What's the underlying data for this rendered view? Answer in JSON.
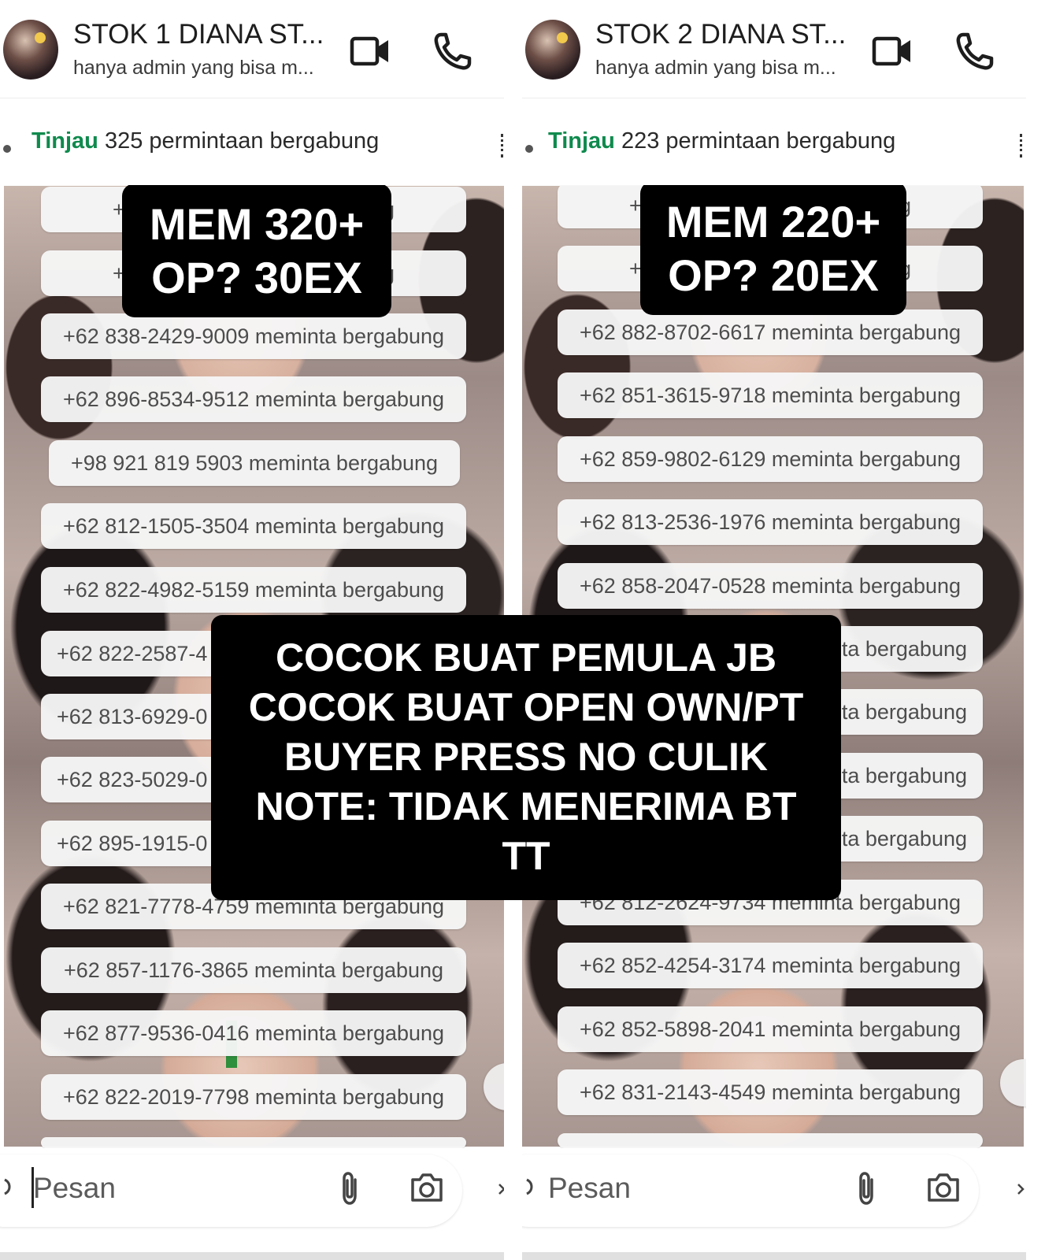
{
  "panels": [
    {
      "title": "STOK 1 DIANA ST...",
      "subtitle": "hanya admin yang bisa m...",
      "review_link": "Tinjau",
      "review_text": "325 permintaan bergabung",
      "stat_line1": "MEM 320+",
      "stat_line2": "OP? 30EX",
      "composer_placeholder": "Pesan",
      "notices": [
        "+62 81… meminta bergabung",
        "+62 85… meminta bergabung",
        "+62 838-2429-9009 meminta bergabung",
        "+62 896-8534-9512 meminta bergabung",
        "+98 921 819 5903 meminta bergabung",
        "+62 812-1505-3504 meminta bergabung",
        "+62 822-4982-5159 meminta bergabung",
        "+62 822-2587-4",
        "+62 813-6929-0",
        "+62 823-5029-0",
        "+62 895-1915-0",
        "+62 821-7778-4759 meminta bergabung",
        "+62 857-1176-3865 meminta bergabung",
        "+62 877-9536-0416 meminta bergabung",
        "+62 822-2019-7798 meminta bergabung"
      ]
    },
    {
      "title": "STOK 2 DIANA ST...",
      "subtitle": "hanya admin yang bisa m...",
      "review_link": "Tinjau",
      "review_text": "223 permintaan bergabung",
      "stat_line1": "MEM 220+",
      "stat_line2": "OP? 20EX",
      "composer_placeholder": "Pesan",
      "notices": [
        "+62 89… meminta bergabung",
        "+62 81… meminta bergabung",
        "+62 882-8702-6617 meminta bergabung",
        "+62 851-3615-9718 meminta bergabung",
        "+62 859-9802-6129 meminta bergabung",
        "+62 813-2536-1976 meminta bergabung",
        "+62 858-2047-0528 meminta bergabung",
        "meminta bergabung",
        "meminta bergabung",
        "meminta bergabung",
        "meminta bergabung",
        "+62 812-2624-9734 meminta bergabung",
        "+62 852-4254-3174 meminta bergabung",
        "+62 852-5898-2041 meminta bergabung",
        "+62 831-2143-4549 meminta bergabung"
      ]
    }
  ],
  "overlay": {
    "lines": [
      "COCOK BUAT PEMULA JB",
      "COCOK BUAT OPEN OWN/PT",
      "BUYER PRESS NO CULIK",
      "NOTE: TIDAK MENERIMA BT",
      "TT"
    ]
  },
  "icons": {
    "header": [
      "video-call-icon",
      "voice-call-icon"
    ],
    "composer": [
      "paperclip-icon",
      "camera-icon"
    ]
  },
  "colors": {
    "review_link": "#0f8a4d",
    "overlay_bg": "#000000",
    "notice_bg": "#f6f6f6"
  }
}
